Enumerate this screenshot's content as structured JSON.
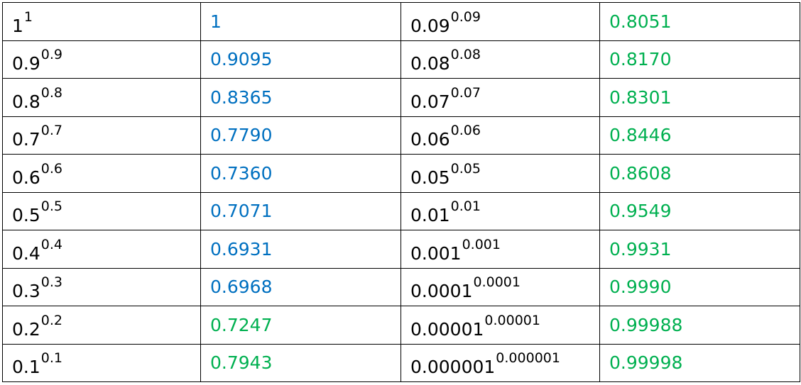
{
  "colors": {
    "blue": "#0070c0",
    "green": "#00b050"
  },
  "rows": [
    {
      "b1": "1",
      "e1": "1",
      "v1": "1",
      "c1": "blue",
      "b2": "0.09",
      "e2": "0.09",
      "v2": "0.8051",
      "c2": "green"
    },
    {
      "b1": "0.9",
      "e1": "0.9",
      "v1": "0.9095",
      "c1": "blue",
      "b2": "0.08",
      "e2": "0.08",
      "v2": "0.8170",
      "c2": "green"
    },
    {
      "b1": "0.8",
      "e1": "0.8",
      "v1": "0.8365",
      "c1": "blue",
      "b2": "0.07",
      "e2": "0.07",
      "v2": "0.8301",
      "c2": "green"
    },
    {
      "b1": "0.7",
      "e1": "0.7",
      "v1": "0.7790",
      "c1": "blue",
      "b2": "0.06",
      "e2": "0.06",
      "v2": "0.8446",
      "c2": "green"
    },
    {
      "b1": "0.6",
      "e1": "0.6",
      "v1": "0.7360",
      "c1": "blue",
      "b2": "0.05",
      "e2": "0.05",
      "v2": "0.8608",
      "c2": "green"
    },
    {
      "b1": "0.5",
      "e1": "0.5",
      "v1": "0.7071",
      "c1": "blue",
      "b2": "0.01",
      "e2": "0.01",
      "v2": "0.9549",
      "c2": "green"
    },
    {
      "b1": "0.4",
      "e1": "0.4",
      "v1": "0.6931",
      "c1": "blue",
      "b2": "0.001",
      "e2": "0.001",
      "v2": "0.9931",
      "c2": "green"
    },
    {
      "b1": "0.3",
      "e1": "0.3",
      "v1": "0.6968",
      "c1": "blue",
      "b2": "0.0001",
      "e2": "0.0001",
      "v2": "0.9990",
      "c2": "green"
    },
    {
      "b1": "0.2",
      "e1": "0.2",
      "v1": "0.7247",
      "c1": "green",
      "b2": "0.00001",
      "e2": "0.00001",
      "v2": "0.99988",
      "c2": "green"
    },
    {
      "b1": "0.1",
      "e1": "0.1",
      "v1": "0.7943",
      "c1": "green",
      "b2": "0.000001",
      "e2": "0.000001",
      "v2": "0.99998",
      "c2": "green"
    }
  ]
}
